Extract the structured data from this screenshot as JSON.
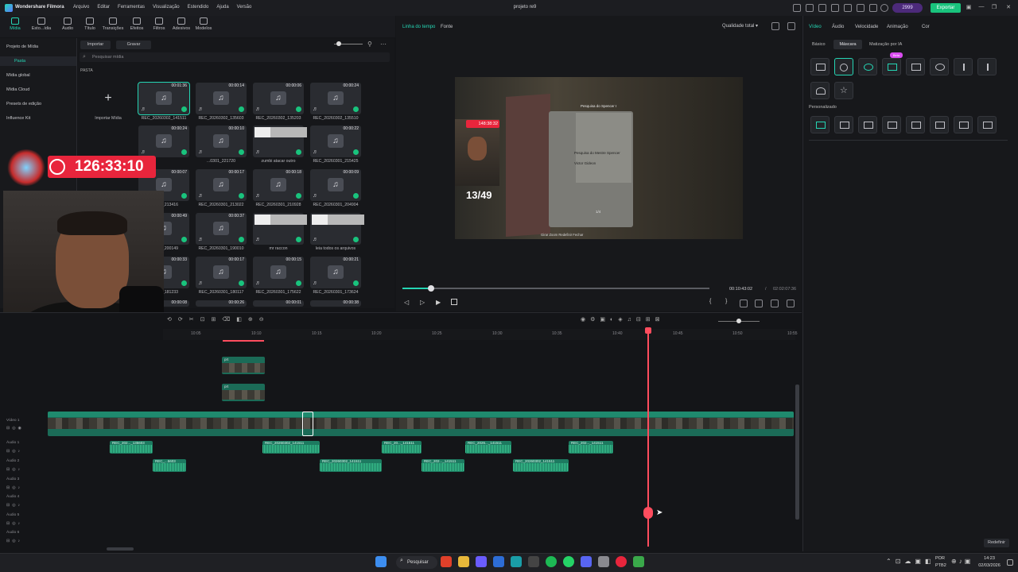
{
  "titlebar": {
    "app_name": "Wondershare Filmora",
    "menus": [
      "Arquivo",
      "Editar",
      "Ferramentas",
      "Visualização",
      "Estendido",
      "Ajuda",
      "Versão"
    ],
    "project_title": "projeto re9",
    "credits": "2999",
    "export_label": "Exportar"
  },
  "toolbar": {
    "tools": [
      "Mídia",
      "Esto...ídia",
      "Áudio",
      "Título",
      "Transições",
      "Efeitos",
      "Filtros",
      "Adesivos",
      "Modelos"
    ]
  },
  "sidebar": {
    "items": [
      "Projeto de Mídia",
      "Pasta",
      "Mídia global",
      "Mídia Cloud",
      "Presets de edição",
      "Influence Kit"
    ]
  },
  "media": {
    "import_label": "Importar",
    "record_label": "Gravar",
    "search_placeholder": "Pesquisar mídia",
    "folder_label": "PASTA",
    "import_tile_label": "Importar Mídia",
    "rows": [
      [
        {
          "name": "REC_20260302_141511",
          "dur": "00:01:36"
        },
        {
          "name": "REC_20260302_135603",
          "dur": "00:00:14"
        },
        {
          "name": "REC_20260302_135203",
          "dur": "00:00:06"
        },
        {
          "name": "REC_20260302_135510",
          "dur": "00:00:24"
        }
      ],
      [
        {
          "name": "",
          "dur": "00:00:24"
        },
        {
          "name": "...0301_221720",
          "dur": "00:00:10"
        },
        {
          "name": "zumbi atacar outro",
          "dur": ""
        },
        {
          "name": "REC_20260301_215425",
          "dur": "00:00:22"
        }
      ],
      [
        {
          "name": "...0301_213416",
          "dur": "00:00:07"
        },
        {
          "name": "REC_20260301_213022",
          "dur": "00:00:17"
        },
        {
          "name": "REC_20260301_210928",
          "dur": "00:00:18"
        },
        {
          "name": "REC_20260301_204904",
          "dur": "00:00:09"
        }
      ],
      [
        {
          "name": "...0301_200149",
          "dur": "00:00:49"
        },
        {
          "name": "REC_20260301_190010",
          "dur": "00:00:37"
        },
        {
          "name": "mr raccon",
          "dur": ""
        },
        {
          "name": "leia todos os arquivos",
          "dur": ""
        }
      ],
      [
        {
          "name": "...0301_181233",
          "dur": "00:00:33"
        },
        {
          "name": "REC_20260301_180117",
          "dur": "00:00:17"
        },
        {
          "name": "REC_20260301_175622",
          "dur": "00:00:15"
        },
        {
          "name": "REC_20260301_173624",
          "dur": "00:00:21"
        }
      ],
      [
        {
          "name": "",
          "dur": "00:00:08"
        },
        {
          "name": "",
          "dur": "00:00:26"
        },
        {
          "name": "",
          "dur": "00:00:01"
        },
        {
          "name": "",
          "dur": "00:00:38"
        }
      ]
    ]
  },
  "preview": {
    "tab_timeline": "Linha do tempo",
    "tab_source": "Fonte",
    "quality": "Qualidade total",
    "current_time": "00:10:43:02",
    "separator": "/",
    "total_time": "02:02:07:36",
    "video": {
      "rec_time": "148:38:32",
      "counter": "13/49",
      "panel_title": "Pesquisa do Spencer I",
      "doc_title": "Pesquisa do Mestre Spencer",
      "doc_author": "Victor Gideon",
      "page": "1/4",
      "footer": "Girar   Zoom   Redefinir   Fechar"
    },
    "progress": 0.09
  },
  "right_panel": {
    "tabs": [
      "Vídeo",
      "Áudio",
      "Velocidade",
      "Animação",
      "Cor"
    ],
    "subtabs": [
      "Básico",
      "Máscara",
      "Matização por IA"
    ],
    "beta": "Beta",
    "custom_label": "Personalizado",
    "reset_label": "Redefinir"
  },
  "overlay": {
    "timer": "126:33:10"
  },
  "timeline": {
    "ruler": [
      "10:05",
      "10:10",
      "10:15",
      "10:20",
      "10:25",
      "10:30",
      "10:35",
      "10:40",
      "10:45",
      "10:50",
      "10:55"
    ],
    "tracks": [
      "Vídeo 1",
      "Áudio 1",
      "Áudio 2",
      "Áudio 3",
      "Áudio 4",
      "Áudio 5",
      "Áudio 6"
    ],
    "audio_clips": [
      {
        "label": "REC_202..._135603",
        "track": 1
      },
      {
        "label": "REC_20260302_141511",
        "track": 1
      },
      {
        "label": "REC_20..._141511",
        "track": 1
      },
      {
        "label": "REC_2026..._141511",
        "track": 1
      },
      {
        "label": "REC_202..._141511",
        "track": 1
      },
      {
        "label": "REC_...5603",
        "track": 2
      },
      {
        "label": "REC_20260302_141511",
        "track": 2
      },
      {
        "label": "REC_202..._141511",
        "track": 2
      },
      {
        "label": "REC_20260302_141511",
        "track": 2
      }
    ],
    "clip_label": "prt"
  },
  "taskbar": {
    "search": "Pesquisar",
    "lang": "POR",
    "layout": "PTB2",
    "time": "14:23",
    "date": "02/03/2026"
  }
}
